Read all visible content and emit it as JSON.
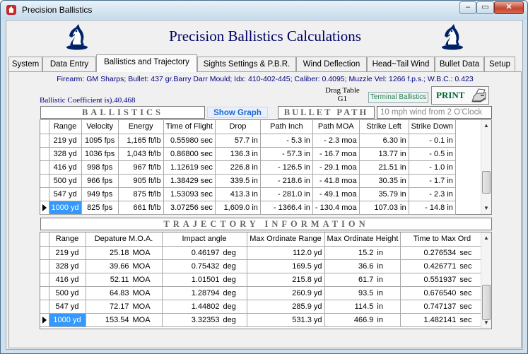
{
  "window": {
    "title": "Precision Ballistics",
    "min": "–",
    "max": "▭",
    "close": "✕"
  },
  "header": {
    "title": "Precision Ballistics Calculations"
  },
  "tabs": [
    {
      "label": "System"
    },
    {
      "label": "Data Entry"
    },
    {
      "label": "Ballistics and Trajectory",
      "active": true
    },
    {
      "label": "Sights Settings & P.B.R."
    },
    {
      "label": "Wind Deflection"
    },
    {
      "label": "Head~Tail Wind"
    },
    {
      "label": "Bullet Data"
    },
    {
      "label": "Setup"
    }
  ],
  "info": {
    "line": "Firearm: GM Sharps;  Bullet: 437 gr.Barry Darr Mould;  Idx: 410-402-445;  Caliber: 0.4095;  Muzzle Vel: 1266 f.p.s.;  W.B.C.: 0.423",
    "bc": "Ballistic Coefficient is).40.468",
    "drag_label": "Drag Table",
    "drag_value": "G1",
    "terminal_button": "Terminal Ballistics",
    "print_button": "PRINT"
  },
  "section": {
    "ballistics": "BALLISTICS",
    "show_graph": "Show Graph",
    "bullet_path": "BULLET PATH",
    "wind": "10 mph wind from 2 O'Clock",
    "trajectory": "TRAJECTORY INFORMATION"
  },
  "ballistics_table": {
    "columns": [
      "Range",
      "Velocity",
      "Energy",
      "Time of Flight",
      "Drop",
      "Path Inch",
      "Path MOA",
      "Strike Left",
      "Strike Down"
    ],
    "rows": [
      [
        "219 yd",
        "1095 fps",
        "1,165 ft/lb",
        "0.55980 sec",
        "57.7 in",
        "- 5.3 in",
        "- 2.3 moa",
        "6.30 in",
        "- 0.1 in"
      ],
      [
        "328 yd",
        "1036 fps",
        "1,043 ft/lb",
        "0.86800 sec",
        "136.3 in",
        "- 57.3 in",
        "- 16.7 moa",
        "13.77 in",
        "- 0.5 in"
      ],
      [
        "416 yd",
        "998 fps",
        "967 ft/lb",
        "1.12619 sec",
        "226.8 in",
        "- 126.5 in",
        "- 29.1 moa",
        "21.51 in",
        "- 1.0 in"
      ],
      [
        "500 yd",
        "966 fps",
        "905 ft/lb",
        "1.38429 sec",
        "339.5 in",
        "- 218.6 in",
        "- 41.8 moa",
        "30.35 in",
        "- 1.7 in"
      ],
      [
        "547 yd",
        "949 fps",
        "875 ft/lb",
        "1.53093 sec",
        "413.3 in",
        "- 281.0 in",
        "- 49.1 moa",
        "35.79 in",
        "- 2.3 in"
      ],
      [
        "1000 yd",
        "825 fps",
        "661 ft/lb",
        "3.07256 sec",
        "1,609.0 in",
        "- 1366.4 in",
        "- 130.4 moa",
        "107.03 in",
        "- 14.8 in"
      ]
    ]
  },
  "trajectory_table": {
    "columns": [
      "Range",
      "Depature M.O.A.",
      "Impact angle",
      "Max Ordinate Range",
      "Max Ordinate Height",
      "Time to Max Ord"
    ],
    "rows": [
      [
        "219 yd",
        "25.18",
        "MOA",
        "0.46197",
        "deg",
        "112.0 yd",
        "15.2",
        "in",
        "0.276534",
        "sec"
      ],
      [
        "328 yd",
        "39.66",
        "MOA",
        "0.75432",
        "deg",
        "169.5 yd",
        "36.6",
        "in",
        "0.426771",
        "sec"
      ],
      [
        "416 yd",
        "52.11",
        "MOA",
        "1.01501",
        "deg",
        "215.8 yd",
        "61.7",
        "in",
        "0.551937",
        "sec"
      ],
      [
        "500 yd",
        "64.83",
        "MOA",
        "1.28794",
        "deg",
        "260.9 yd",
        "93.5",
        "in",
        "0.676540",
        "sec"
      ],
      [
        "547 yd",
        "72.17",
        "MOA",
        "1.44802",
        "deg",
        "285.9 yd",
        "114.5",
        "in",
        "0.747137",
        "sec"
      ],
      [
        "1000 yd",
        "153.54",
        "MOA",
        "3.32353",
        "deg",
        "531.3 yd",
        "466.9",
        "in",
        "1.482141",
        "sec"
      ]
    ]
  },
  "colors": {
    "accent": "#000080",
    "selection": "#3399ff",
    "terminal": "#2e7d5b",
    "print": "#006633"
  }
}
